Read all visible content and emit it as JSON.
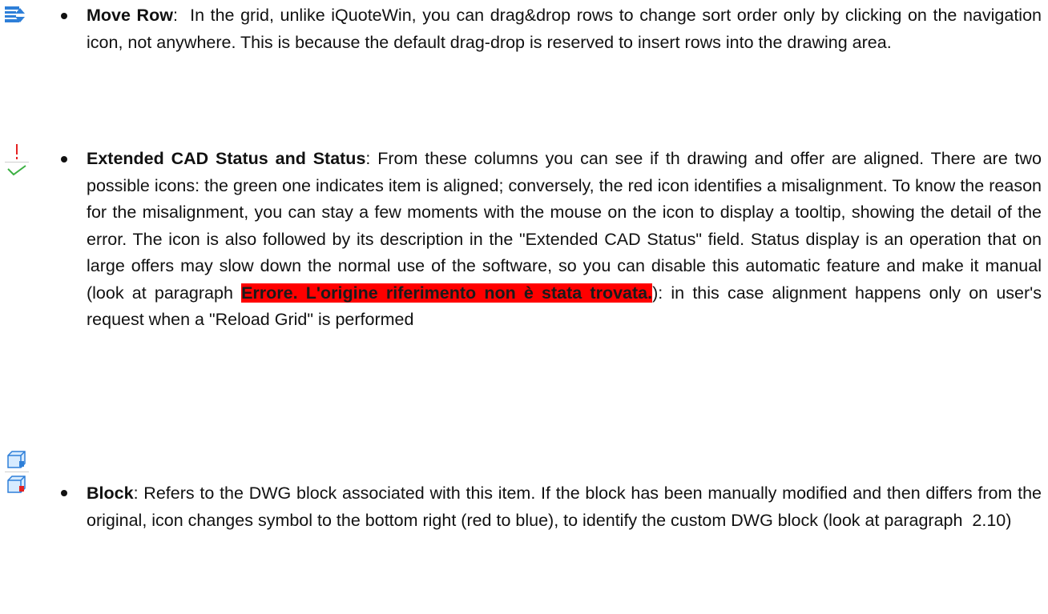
{
  "items": [
    {
      "term": "Move Row",
      "sep": ":  ",
      "text": "In the grid, unlike iQuoteWin, you can drag&drop rows to change sort order only by clicking on the navigation icon, not anywhere. This is because the default drag-drop is reserved to insert rows into the drawing area.",
      "icon": "move-row-icon"
    },
    {
      "term": "Extended CAD Status and Status",
      "sep": ": ",
      "text": "From these columns you can see if th drawing and offer are aligned. There are two possible icons: the green one indicates item is aligned; conversely, the red icon identifies a misalignment. To know the reason for the misalignment, you can stay a few moments with the mouse on the icon to display a tooltip, showing the detail of the error. The icon is also followed by its description in the \"Extended CAD Status\" field. Status display is an operation that on large offers may slow down the normal use of the software, so you can disable this automatic feature and make it manual (look at paragraph ",
      "error_ref": "Errore. L'origine riferimento non è stata trovata.",
      "text_after": "): in this case alignment happens only on user's request when a \"Reload Grid\" is performed",
      "icons": [
        "exclamation-icon",
        "checkmark-icon"
      ]
    },
    {
      "term": "Block",
      "sep": ": ",
      "text": "Refers to the DWG block associated with this item. If the block has been manually modified and then differs from the original, icon changes symbol to the bottom right (red to blue), to identify the custom DWG block (look at paragraph  2.10)",
      "icons": [
        "block-blue-icon",
        "block-red-icon"
      ]
    }
  ],
  "colors": {
    "error_highlight": "#ff0000",
    "icon_blue": "#2e7fd8",
    "icon_green": "#3cb043",
    "icon_red": "#e52222"
  }
}
